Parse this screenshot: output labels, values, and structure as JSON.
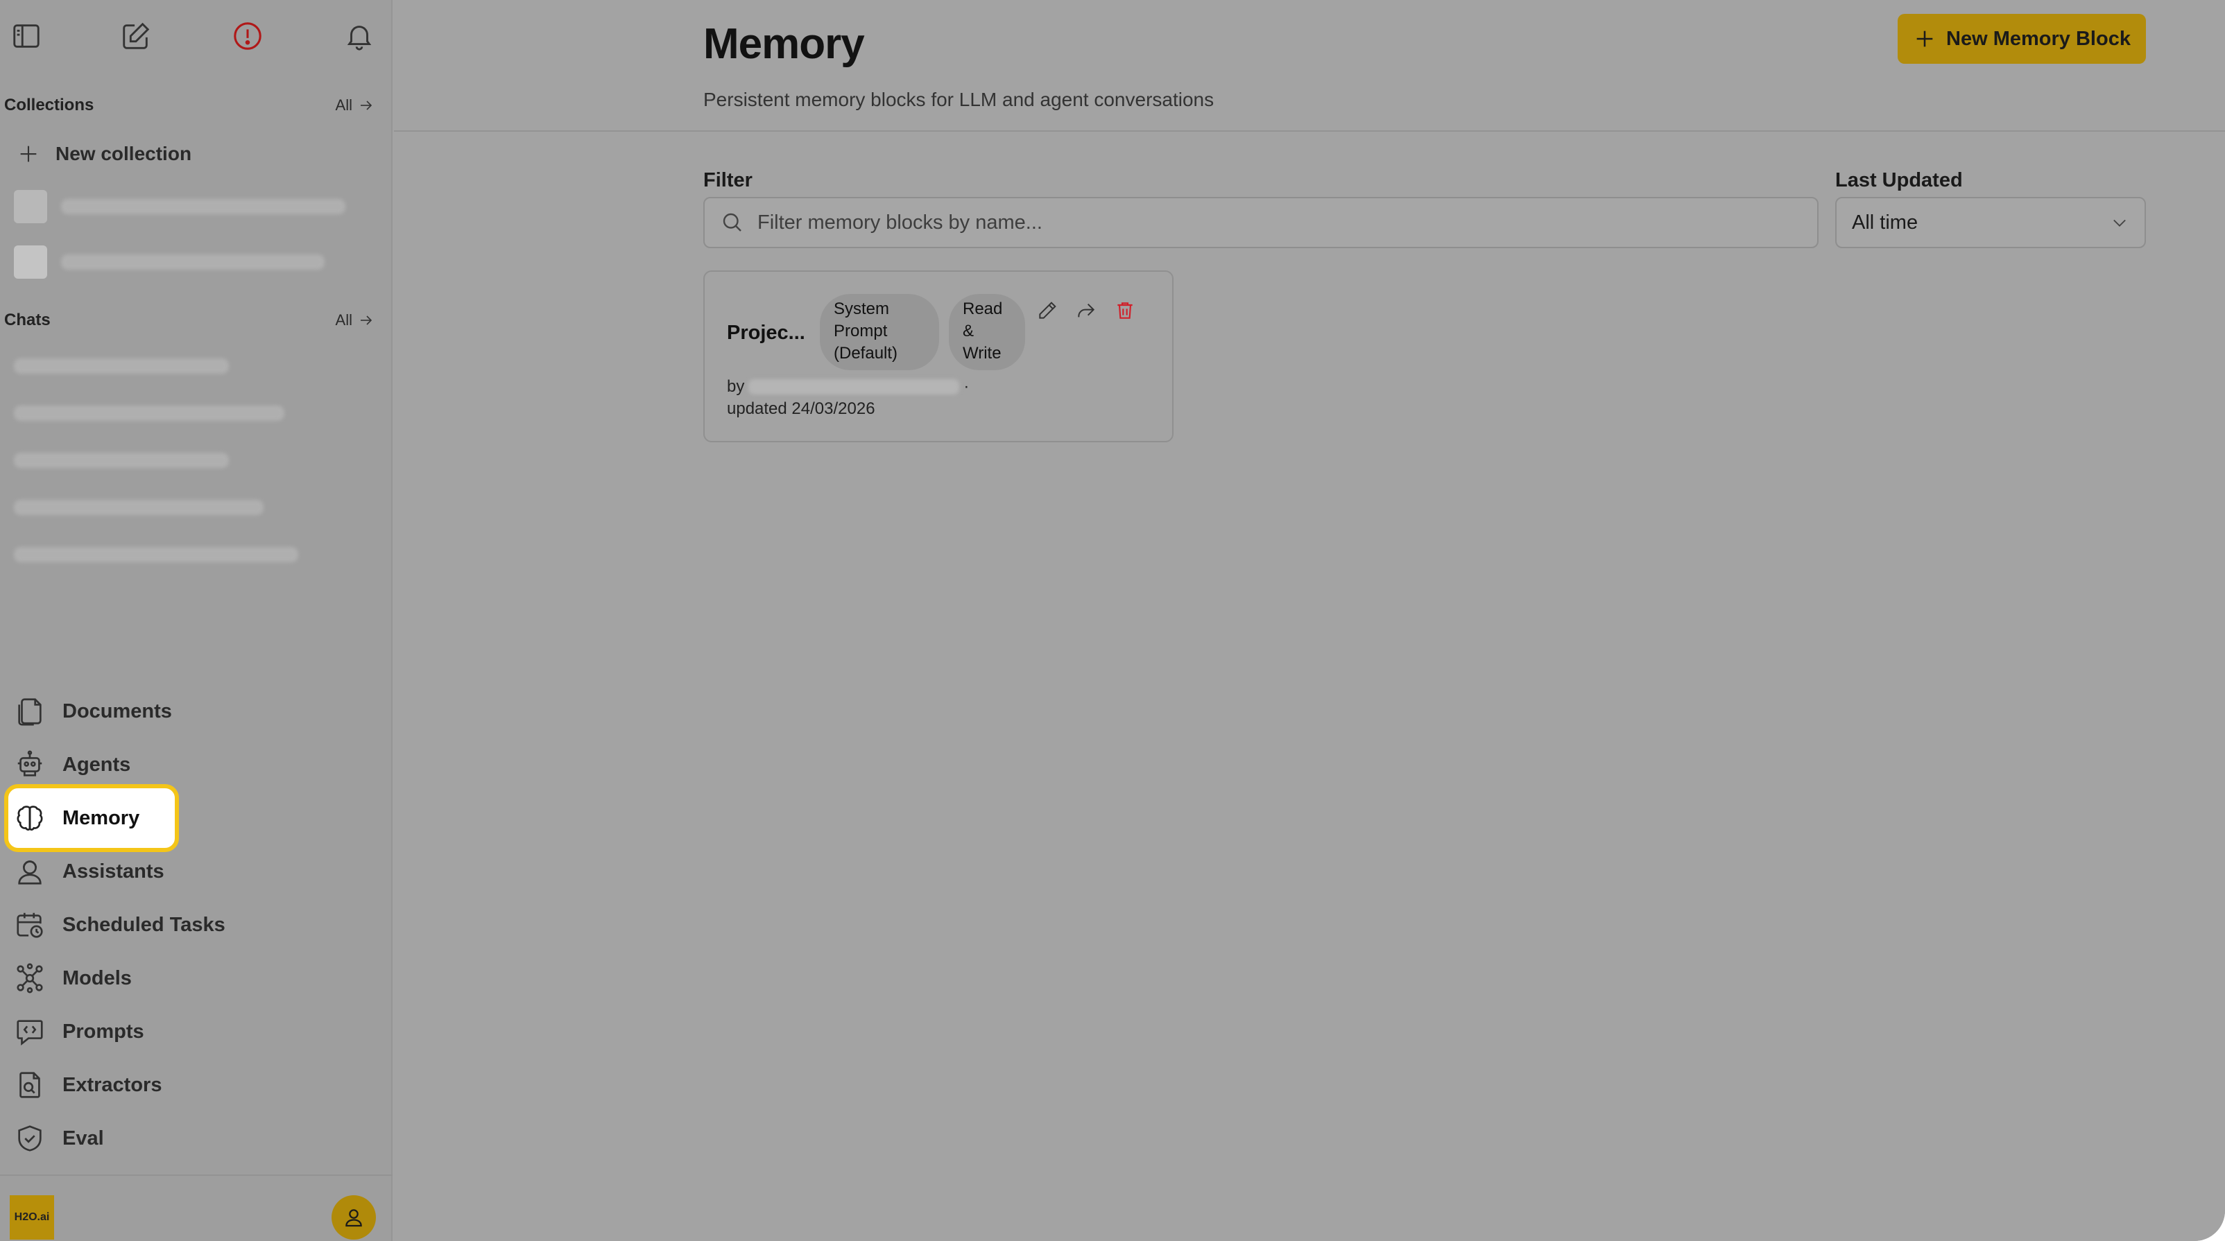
{
  "sidebar": {
    "icons": {
      "toggle": "sidebar-toggle-icon",
      "new_chat": "compose-icon",
      "alert": "alert-circle-icon",
      "notifications": "bell-icon"
    },
    "collections": {
      "title": "Collections",
      "all_label": "All",
      "new_label": "New collection"
    },
    "chats": {
      "title": "Chats",
      "all_label": "All"
    },
    "nav": [
      {
        "label": "Documents",
        "icon": "documents-icon"
      },
      {
        "label": "Agents",
        "icon": "robot-icon"
      },
      {
        "label": "Memory",
        "icon": "brain-icon",
        "active": true
      },
      {
        "label": "Assistants",
        "icon": "assistant-icon"
      },
      {
        "label": "Scheduled Tasks",
        "icon": "calendar-clock-icon"
      },
      {
        "label": "Models",
        "icon": "models-icon"
      },
      {
        "label": "Prompts",
        "icon": "prompt-icon"
      },
      {
        "label": "Extractors",
        "icon": "extractor-icon"
      },
      {
        "label": "Eval",
        "icon": "shield-check-icon"
      }
    ],
    "footer": {
      "logo_text": "H2O.ai",
      "avatar_icon": "user-icon"
    }
  },
  "main": {
    "title": "Memory",
    "subtitle": "Persistent memory blocks for LLM and agent conversations",
    "new_button_label": "New Memory Block",
    "filter": {
      "label": "Filter",
      "placeholder": "Filter memory blocks by name..."
    },
    "last_updated": {
      "label": "Last Updated",
      "value": "All time"
    },
    "cards": [
      {
        "name": "Projec...",
        "tag_type": "System Prompt (Default)",
        "tag_access": "Read & Write",
        "by_label": "by",
        "separator": "·",
        "updated": "updated 24/03/2026"
      }
    ]
  },
  "colors": {
    "accent": "#F4C518",
    "overlay_bg": "#A3A3A3",
    "danger": "#D0202A"
  }
}
